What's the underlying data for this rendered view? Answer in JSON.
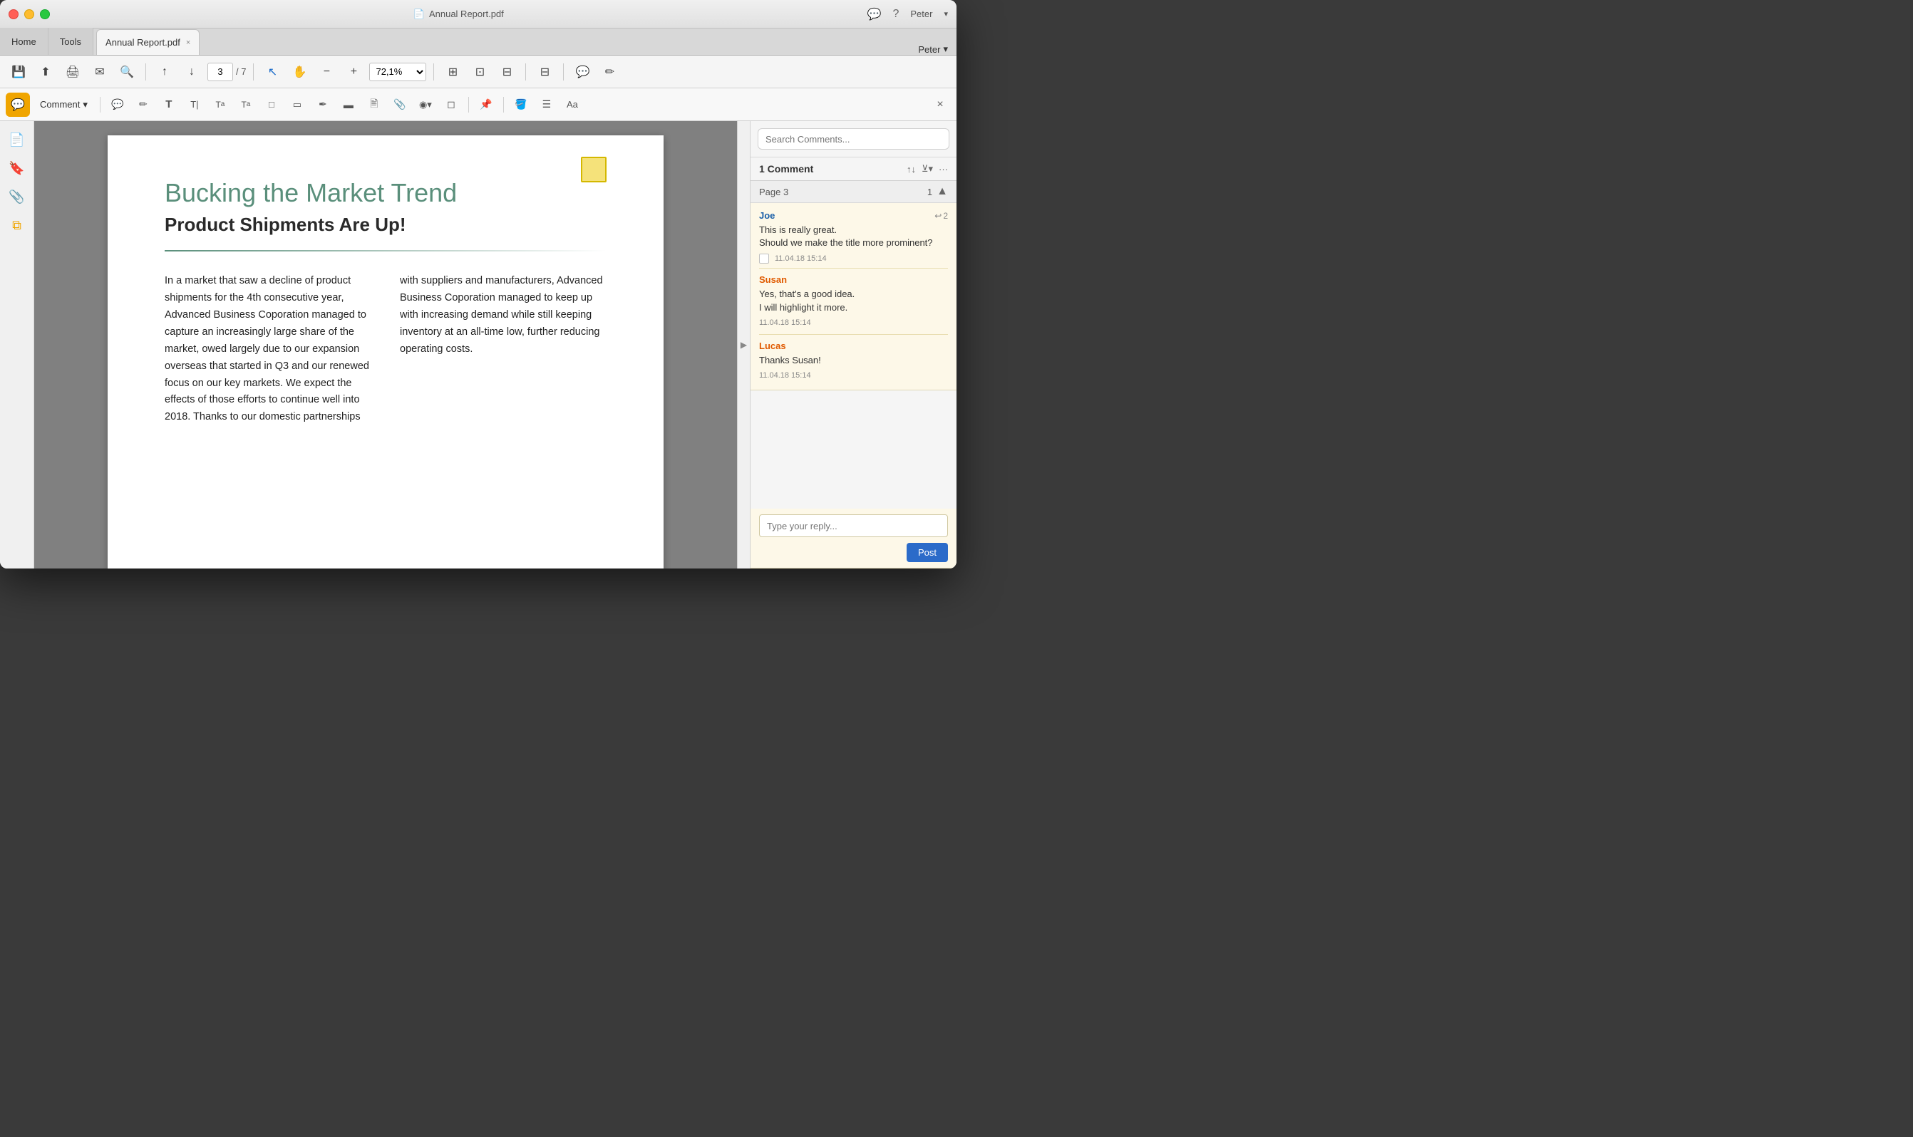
{
  "window": {
    "title": "Annual Report.pdf",
    "titlebar_icon": "📄"
  },
  "tabs": {
    "home": "Home",
    "tools": "Tools",
    "active": "Annual Report.pdf",
    "close": "×"
  },
  "user": {
    "name": "Peter",
    "chat_icon": "💬",
    "help_icon": "?"
  },
  "toolbar": {
    "save": "💾",
    "upload": "⬆",
    "print": "🖨",
    "email": "✉",
    "search": "🔍",
    "prev": "↑",
    "next": "↓",
    "page_current": "3",
    "page_separator": "/ 7",
    "cursor": "↖",
    "hand": "✋",
    "zoom_out": "−",
    "zoom_in": "+",
    "zoom_value": "72,1%",
    "fit_page": "⊞",
    "fit_width": "⊡",
    "fit_height": "⊟",
    "forms": "⊟",
    "comment_icon": "💬",
    "edit_icon": "✏"
  },
  "comment_toolbar": {
    "comment_label": "Comment",
    "speech_bubble": "💬",
    "pencil": "✏",
    "text_T": "T",
    "text_cursor": "T|",
    "text_super": "T²",
    "text_sub": "T₂",
    "text_box": "□T",
    "highlight_box": "▭",
    "pen": "✒",
    "highlighter": "▬",
    "stamp": "🖹",
    "attach": "📎",
    "shapes": "◉",
    "eraser": "◻",
    "pin": "📌",
    "fill": "🪣",
    "lines": "☰",
    "font": "Aa",
    "close": "×"
  },
  "left_sidebar": {
    "icons": [
      "📄",
      "🔖",
      "📎",
      "⧉"
    ]
  },
  "pdf": {
    "title": "Bucking the Market Trend",
    "subtitle": "Product Shipments Are Up!",
    "col1": "In a market that saw a decline of product shipments for the 4th consecutive year, Advanced Business Coporation managed to capture an increasingly large share of the market, owed largely due to our expansion overseas that started in Q3 and our renewed focus on our key markets. We expect the effects of those efforts to continue well into 2018. Thanks to our domestic partnerships",
    "col2": "with suppliers and manufacturers, Advanced Business Coporation managed to keep up with increasing demand while still keeping inventory at an all-time low, further reducing operating costs."
  },
  "comments_panel": {
    "search_placeholder": "Search Comments...",
    "header_label": "1 Comment",
    "page_label": "Page 3",
    "page_count": "1",
    "thread": {
      "author": "Joe",
      "reply_count": "2",
      "text_line1": "This is really great.",
      "text_line2": "Should we make the title more prominent?",
      "timestamp": "11.04.18  15:14"
    },
    "reply1": {
      "author": "Susan",
      "text_line1": "Yes, that's a good idea.",
      "text_line2": "I will highlight it more.",
      "timestamp": "11.04.18  15:14"
    },
    "reply2": {
      "author": "Lucas",
      "text": "Thanks Susan!",
      "timestamp": "11.04.18  15:14"
    },
    "reply_placeholder": "Type your reply...",
    "post_button": "Post"
  }
}
